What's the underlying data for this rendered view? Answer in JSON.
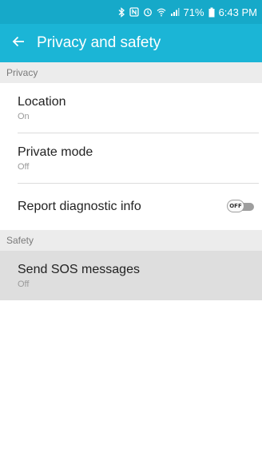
{
  "status_bar": {
    "battery_percent": "71%",
    "time": "6:43 PM",
    "icons": [
      "bluetooth-icon",
      "nfc-icon",
      "alarm-icon",
      "wifi-icon",
      "signal-icon",
      "battery-icon"
    ]
  },
  "app_bar": {
    "title": "Privacy and safety",
    "back_icon": "arrow-left-icon"
  },
  "sections": {
    "privacy": {
      "header": "Privacy",
      "location": {
        "title": "Location",
        "subtitle": "On"
      },
      "private_mode": {
        "title": "Private mode",
        "subtitle": "Off"
      },
      "report_diagnostic": {
        "title": "Report diagnostic info",
        "toggle_label": "OFF",
        "toggle_state": "off"
      }
    },
    "safety": {
      "header": "Safety",
      "send_sos": {
        "title": "Send SOS messages",
        "subtitle": "Off"
      }
    }
  },
  "colors": {
    "status_bar": "#16a9c9",
    "app_bar": "#1bb5d6",
    "section_header_bg": "#ececec",
    "highlight_bg": "#dedede"
  }
}
